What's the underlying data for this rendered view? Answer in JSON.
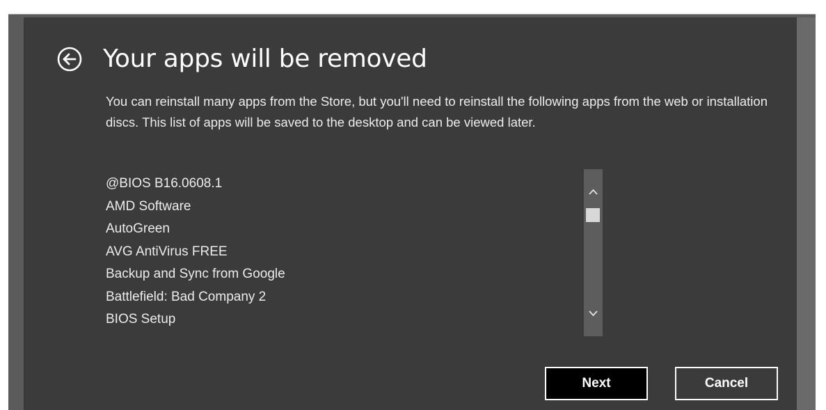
{
  "dialog": {
    "title": "Your apps will be removed",
    "description": "You can reinstall many apps from the Store, but you'll need to reinstall the following apps from the web or installation discs. This list of apps will be saved to the desktop and can be viewed later.",
    "back_icon": "circle-arrow-left-icon"
  },
  "app_list": {
    "items": [
      "@BIOS B16.0608.1",
      "AMD Software",
      "AutoGreen",
      "AVG AntiVirus FREE",
      "Backup and Sync from Google",
      "Battlefield: Bad Company 2",
      "BIOS Setup"
    ],
    "scroll_up_icon": "chevron-up-icon",
    "scroll_down_icon": "chevron-down-icon"
  },
  "buttons": {
    "next_label": "Next",
    "cancel_label": "Cancel"
  },
  "colors": {
    "dialog_background": "#3b3b3b",
    "frame_background": "#5b5b5b",
    "text": "#ececec",
    "button_background": "#000000",
    "button_border": "#ffffff"
  }
}
